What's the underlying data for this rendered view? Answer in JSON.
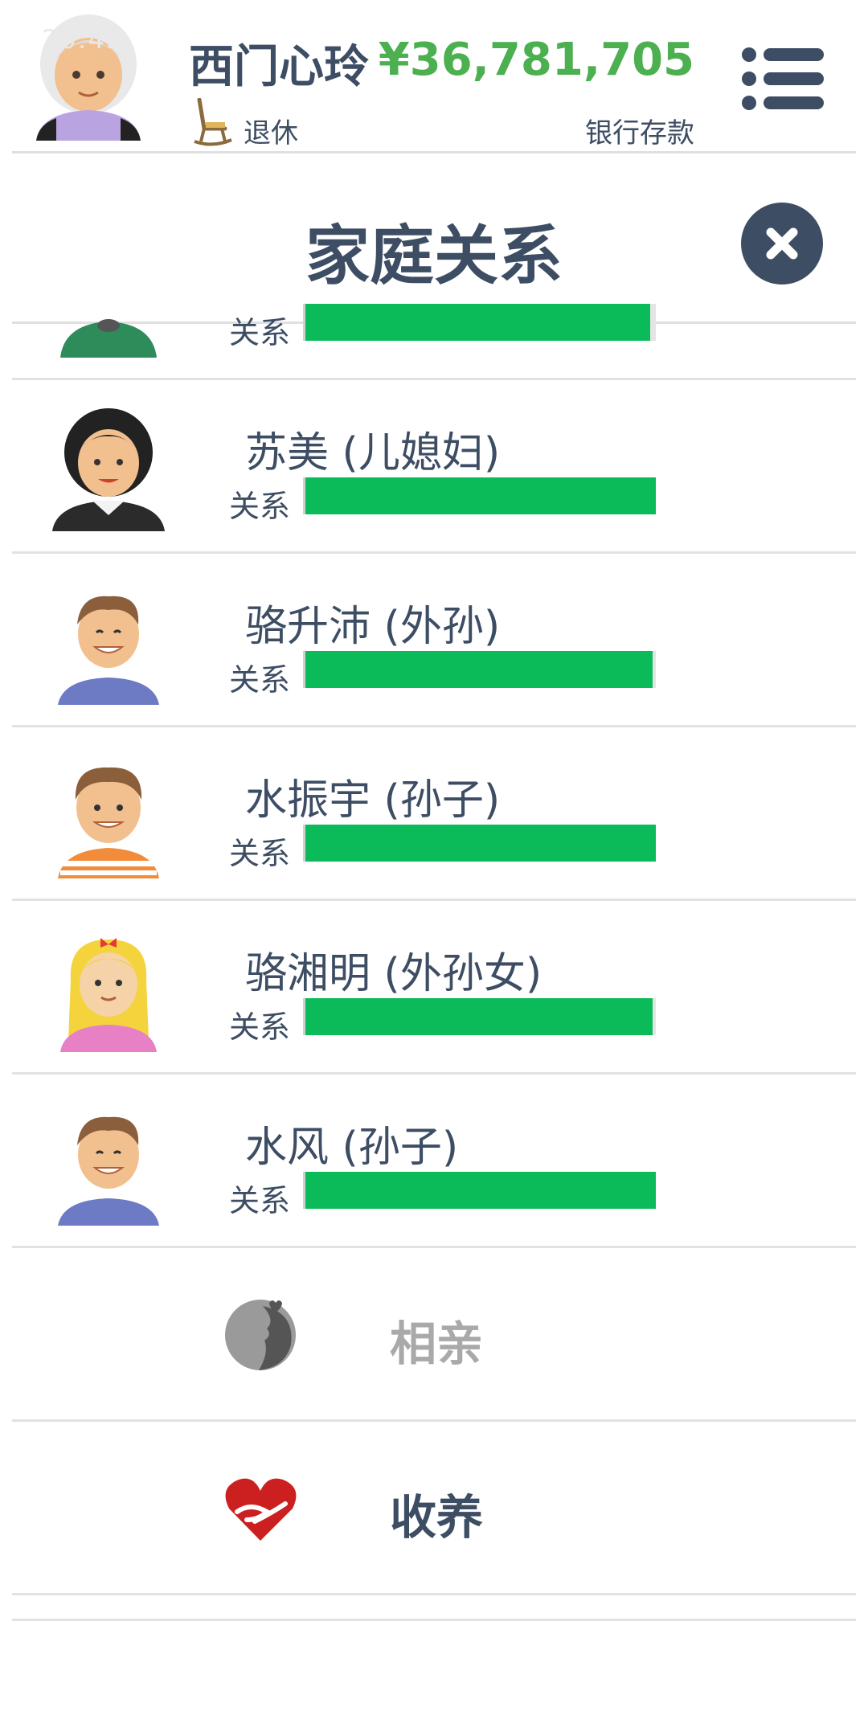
{
  "topbar": {
    "status_faint": "20:45",
    "player_name": "西门心玲",
    "status_label": "退休",
    "money": "¥36,781,705",
    "money_label": "银行存款"
  },
  "section": {
    "title": "家庭关系"
  },
  "family": [
    {
      "name": "",
      "rel_label": "关系",
      "relationship": 0.985
    },
    {
      "name": "苏美 (儿媳妇)",
      "rel_label": "关系",
      "relationship": 1.0
    },
    {
      "name": "骆升沛 (外孙)",
      "rel_label": "关系",
      "relationship": 0.99
    },
    {
      "name": "水振宇 (孙子)",
      "rel_label": "关系",
      "relationship": 1.0
    },
    {
      "name": "骆湘明 (外孙女)",
      "rel_label": "关系",
      "relationship": 0.99
    },
    {
      "name": "水风 (孙子)",
      "rel_label": "关系",
      "relationship": 1.0
    }
  ],
  "actions": [
    {
      "label": "相亲",
      "icon": "couple-silhouette-icon",
      "enabled": false,
      "color": "#a9a9a9"
    },
    {
      "label": "收养",
      "icon": "heart-hands-icon",
      "enabled": true,
      "color": "#3d4d63"
    }
  ],
  "colors": {
    "accent_dark": "#3d4d63",
    "money_green": "#4caf50",
    "bar_green": "#0bbb5a",
    "heart_red": "#cc1f1f"
  }
}
